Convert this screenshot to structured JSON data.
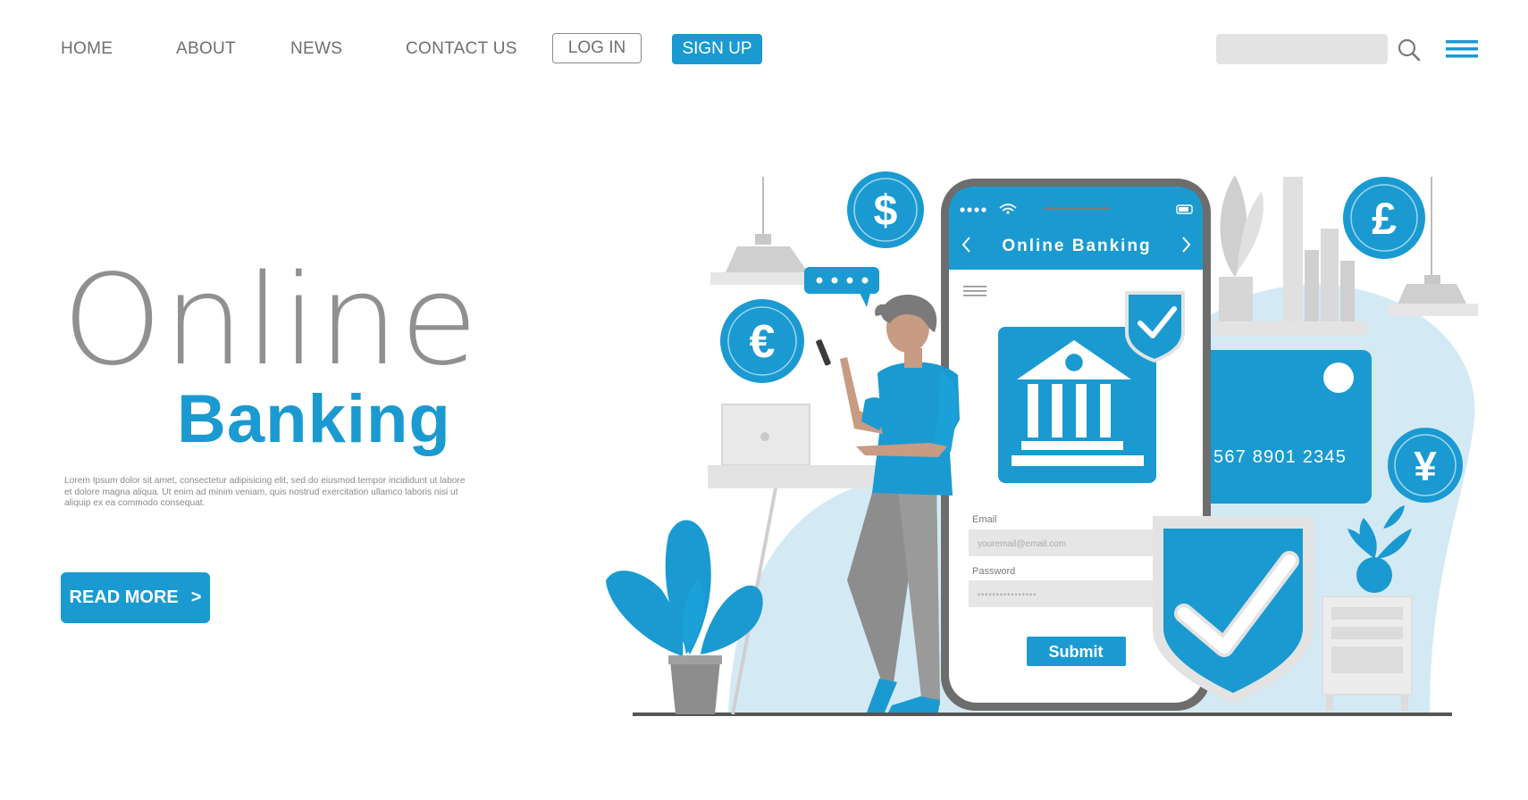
{
  "nav": {
    "links": [
      "HOME",
      "ABOUT",
      "NEWS",
      "CONTACT US"
    ],
    "login_label": "LOG IN",
    "signup_label": "SIGN UP",
    "search_placeholder": ""
  },
  "hero": {
    "title_line1": "Online",
    "title_line2": "Banking",
    "body": "Lorem Ipsum dolor sit amet, consectetur adipisicing elit, sed do eiusmod tempor incididunt ut labore et dolore magna aliqua. Ut enim ad minim veniam, quis nostrud exercitation ullamco laboris nisi ut aliquip ex ea commodo consequat.",
    "read_more_label": "READ MORE",
    "read_more_arrow": ">"
  },
  "phone": {
    "header_title": "Online Banking",
    "email_label": "Email",
    "email_placeholder": "youremail@email.com",
    "password_label": "Password",
    "password_placeholder": "••••••••••••••••",
    "submit_label": "Submit"
  },
  "card": {
    "number": "567 8901 2345"
  },
  "currency": {
    "dollar": "$",
    "euro": "€",
    "pound": "£",
    "yen": "¥"
  },
  "colors": {
    "accent": "#1a9ad1",
    "light_accent": "#d3eaf5",
    "gray": "#909090",
    "light_gray": "#e3e3e3"
  }
}
